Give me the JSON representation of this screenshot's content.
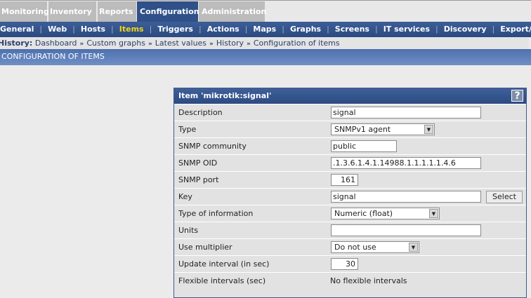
{
  "tabs": [
    "Monitoring",
    "Inventory",
    "Reports",
    "Configuration",
    "Administration"
  ],
  "nav": [
    "General",
    "Web",
    "Hosts",
    "Items",
    "Triggers",
    "Actions",
    "Maps",
    "Graphs",
    "Screens",
    "IT services",
    "Discovery",
    "Export/Imp"
  ],
  "breadcrumb": {
    "label": "History:",
    "items": [
      "Dashboard",
      "Custom graphs",
      "Latest values",
      "History",
      "Configuration of items"
    ]
  },
  "section_title": "CONFIGURATION OF ITEMS",
  "form": {
    "title": "Item 'mikrotik:signal'",
    "help": "?",
    "description": {
      "label": "Description",
      "value": "signal"
    },
    "type": {
      "label": "Type",
      "value": "SNMPv1 agent"
    },
    "community": {
      "label": "SNMP community",
      "value": "public"
    },
    "oid": {
      "label": "SNMP OID",
      "value": ".1.3.6.1.4.1.14988.1.1.1.1.1.4.6"
    },
    "port": {
      "label": "SNMP port",
      "value": "161"
    },
    "key": {
      "label": "Key",
      "value": "signal",
      "button": "Select"
    },
    "info_type": {
      "label": "Type of information",
      "value": "Numeric (float)"
    },
    "units": {
      "label": "Units",
      "value": ""
    },
    "multiplier": {
      "label": "Use multiplier",
      "value": "Do not use"
    },
    "interval": {
      "label": "Update interval (in sec)",
      "value": "30"
    },
    "flex": {
      "label": "Flexible intervals (sec)",
      "value": "No flexible intervals"
    }
  }
}
